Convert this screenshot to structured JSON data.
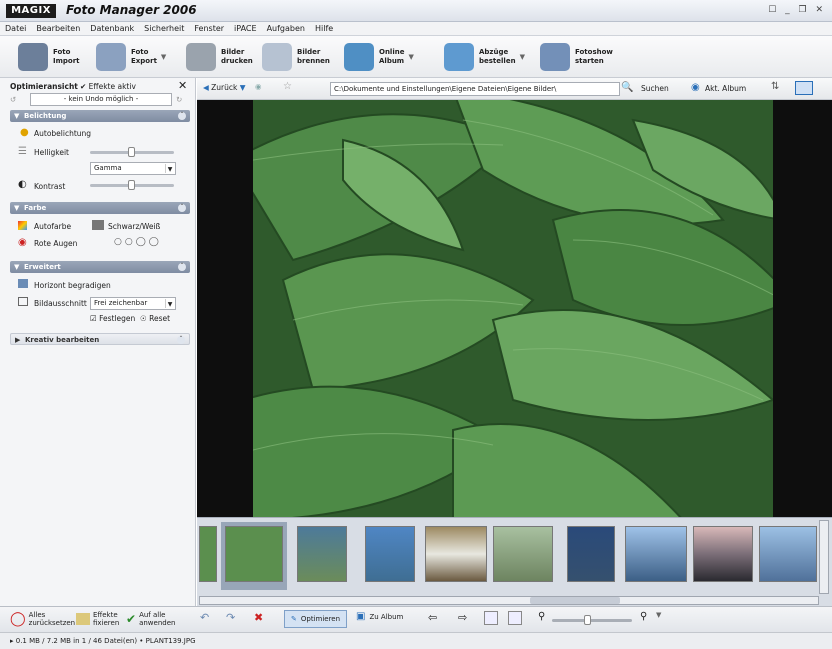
{
  "window": {
    "logo": "MAGIX",
    "title": "Foto Manager 2006",
    "controls": "☐ _ ❐ ✕"
  },
  "menu": [
    "Datei",
    "Bearbeiten",
    "Datenbank",
    "Sicherheit",
    "Fenster",
    "iPACE",
    "Aufgaben",
    "Hilfe"
  ],
  "toolbar": [
    {
      "l1": "Foto",
      "l2": "Import",
      "color": "#6c7f9a"
    },
    {
      "l1": "Foto",
      "l2": "Export",
      "color": "#8ba1c0"
    },
    {
      "l1": "Bilder",
      "l2": "drucken",
      "color": "#9aa3ad"
    },
    {
      "l1": "Bilder",
      "l2": "brennen",
      "color": "#b6c2d2"
    },
    {
      "l1": "Online",
      "l2": "Album",
      "color": "#4f8fc4"
    },
    {
      "l1": "Abzüge",
      "l2": "bestellen",
      "color": "#5e9ad0"
    },
    {
      "l1": "Fotoshow",
      "l2": "starten",
      "color": "#7390b8"
    }
  ],
  "left": {
    "header": "Optimieransicht",
    "effects": "Effekte aktiv",
    "undo": "- kein Undo möglich -",
    "belichtung": {
      "title": "Belichtung",
      "auto": "Autobelichtung",
      "hell": "Helligkeit",
      "gamma": "Gamma",
      "kontrast": "Kontrast"
    },
    "farbe": {
      "title": "Farbe",
      "auto": "Autofarbe",
      "sw": "Schwarz/Weiß",
      "rote": "Rote Augen"
    },
    "erweitert": {
      "title": "Erweitert",
      "horizont": "Horizont begradigen",
      "ausschnitt": "Bildausschnitt",
      "frei": "Frei zeichenbar",
      "festlegen": "Festlegen",
      "reset": "Reset"
    },
    "kreativ": {
      "title": "Kreativ bearbeiten"
    }
  },
  "nav": {
    "back": "Zurück",
    "path": "C:\\Dokumente und Einstellungen\\Eigene Dateien\\Eigene Bilder\\",
    "search": "Suchen",
    "album": "Akt. Album"
  },
  "bottom": {
    "reset": "Alles zurücksetzen",
    "fix": "Effekte fixieren",
    "apply": "Auf alle anwenden",
    "optimize": "Optimieren",
    "toalbum": "Zu Album"
  },
  "status": "0.1 MB / 7.2 MB in 1 / 46 Datei(en)  •  PLANT139.JPG",
  "thumbs": [
    "#5b8f4e",
    "#4d7a9a",
    "#3f6e93",
    "#9d8a62",
    "#6d8460",
    "#35506e",
    "#3c5f86",
    "#7b6e78",
    "#50719a"
  ]
}
